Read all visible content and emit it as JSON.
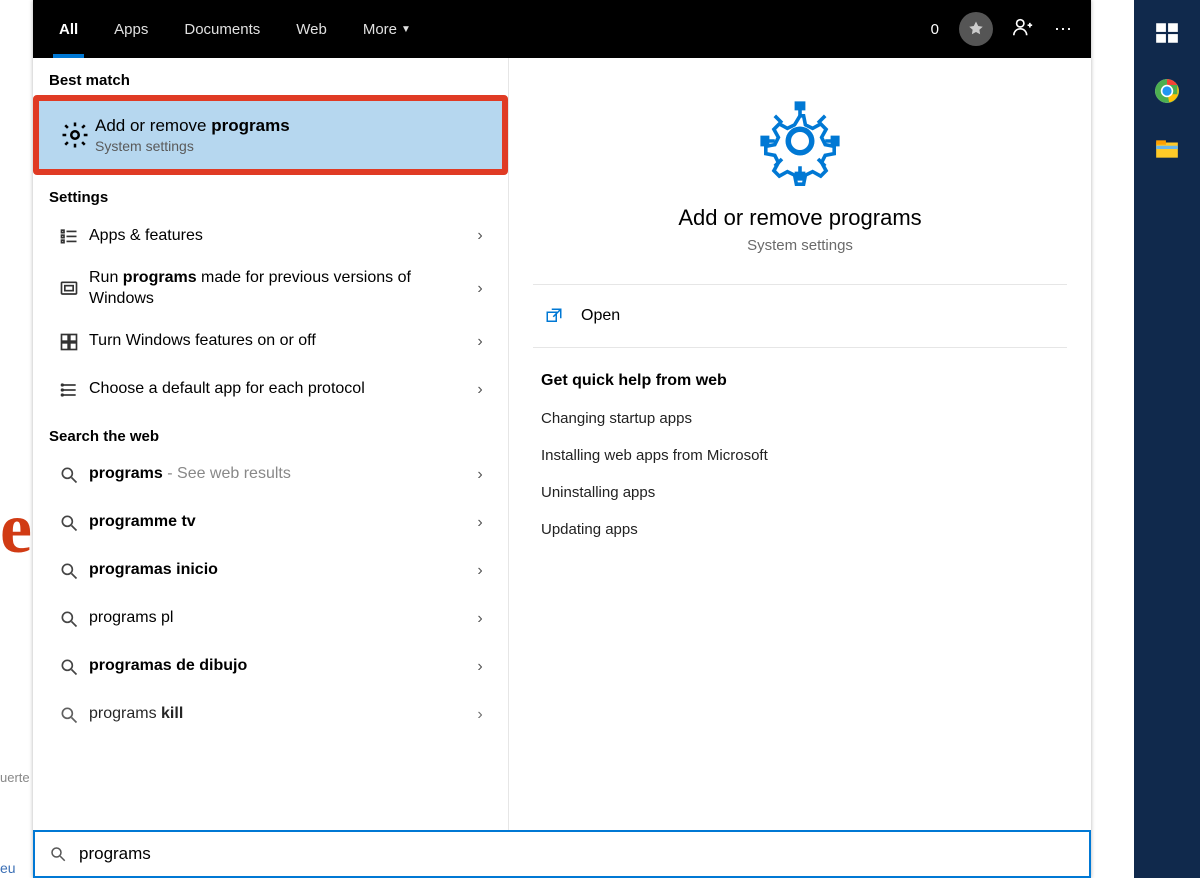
{
  "tabs": {
    "all": "All",
    "apps": "Apps",
    "documents": "Documents",
    "web": "Web",
    "more": "More"
  },
  "rewards_count": "0",
  "sections": {
    "best_match": "Best match",
    "settings": "Settings",
    "search_web": "Search the web"
  },
  "best_match": {
    "title_pre": "Add or remove ",
    "title_bold": "programs",
    "subtitle": "System settings"
  },
  "settings_results": [
    {
      "label_pre": "",
      "label_bold": "",
      "label_plain": "Apps & features",
      "icon": "list"
    },
    {
      "label_pre": "Run ",
      "label_bold": "programs",
      "label_post": " made for previous versions of Windows",
      "icon": "compat"
    },
    {
      "label_pre": "",
      "label_bold": "",
      "label_plain": "Turn Windows features on or off",
      "icon": "features"
    },
    {
      "label_pre": "",
      "label_bold": "",
      "label_plain": "Choose a default app for each protocol",
      "icon": "list"
    }
  ],
  "web_results": [
    {
      "bold": "programs",
      "post": "",
      "suffix": " - See web results"
    },
    {
      "bold": "programme tv",
      "post": "",
      "suffix": ""
    },
    {
      "bold": "programas inicio",
      "post": "",
      "suffix": ""
    },
    {
      "bold": "",
      "post": "programs pl",
      "suffix": ""
    },
    {
      "bold": "programas de dibujo",
      "post": "",
      "suffix": ""
    },
    {
      "bold": "",
      "post": "programs ",
      "bold2": "kill",
      "suffix": ""
    }
  ],
  "search_value": "programs",
  "right_panel": {
    "title": "Add or remove programs",
    "subtitle": "System settings",
    "open": "Open",
    "quick_help_header": "Get quick help from web",
    "links": [
      "Changing startup apps",
      "Installing web apps from Microsoft",
      "Uninstalling apps",
      "Updating apps"
    ]
  }
}
